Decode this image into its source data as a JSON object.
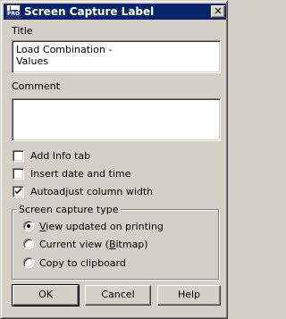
{
  "window": {
    "title": "Screen Capture Label",
    "icon": "pro-app-icon",
    "close_glyph": "✕"
  },
  "title_field": {
    "label": "Title",
    "value": "Load Combination -\nValues"
  },
  "comment_field": {
    "label": "Comment",
    "value": ""
  },
  "options": [
    {
      "label": "Add Info tab",
      "checked": false
    },
    {
      "label": "Insert date and time",
      "checked": false
    },
    {
      "label": "Autoadjust column width",
      "checked": true
    }
  ],
  "capture_group": {
    "legend": "Screen capture type",
    "radios": [
      {
        "label_pre": "",
        "label_u": "V",
        "label_post": "iew updated on printing",
        "selected": true
      },
      {
        "label_pre": "Current view (",
        "label_u": "B",
        "label_post": "itmap)",
        "selected": false
      },
      {
        "label_pre": "Copy to clipboard",
        "label_u": "",
        "label_post": "",
        "selected": false
      }
    ]
  },
  "buttons": {
    "ok": "OK",
    "cancel": "Cancel",
    "help": "Help"
  }
}
